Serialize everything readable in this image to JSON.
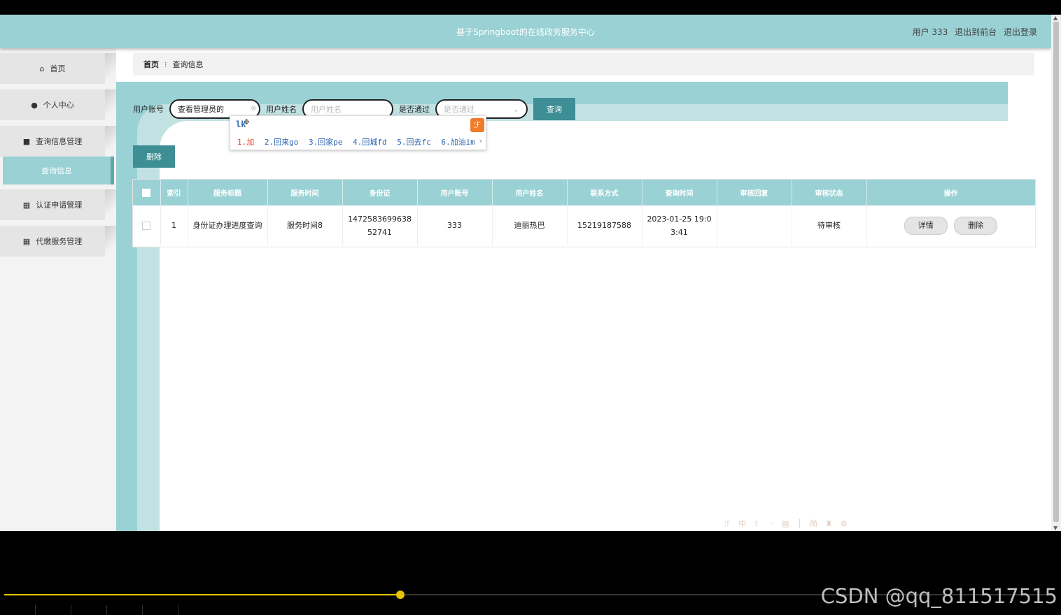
{
  "header": {
    "title": "基于Springboot的在线政务服务中心",
    "user_label": "用户 333",
    "to_front": "退出到前台",
    "logout": "退出登录"
  },
  "sidebar": {
    "items": [
      {
        "label": "首页",
        "icon": "home-icon"
      },
      {
        "label": "个人中心",
        "icon": "user-icon"
      },
      {
        "label": "查询信息管理",
        "icon": "ticket-icon"
      },
      {
        "label": "查询信息",
        "icon": "",
        "active": true
      },
      {
        "label": "认证申请管理",
        "icon": "grid-icon"
      },
      {
        "label": "代缴服务管理",
        "icon": "grid-icon"
      }
    ]
  },
  "breadcrumb": {
    "home": "首页",
    "current": "查询信息"
  },
  "search": {
    "account_label": "用户账号",
    "account_value": "查看管理员的",
    "name_label": "用户姓名",
    "name_placeholder": "用户姓名",
    "pass_label": "是否通过",
    "pass_placeholder": "是否通过",
    "query_button": "查询"
  },
  "actions": {
    "delete_button": "删除"
  },
  "ime": {
    "composition": "lk",
    "candidates": [
      "1.加",
      "2.回来go",
      "3.回家pe",
      "4.回城fd",
      "5.回去fc",
      "6.加油im"
    ]
  },
  "table": {
    "headers": [
      "索引",
      "服务标题",
      "服务时间",
      "身份证",
      "用户账号",
      "用户姓名",
      "联系方式",
      "查询时间",
      "审核回复",
      "审核状态",
      "操作"
    ],
    "rows": [
      {
        "index": "1",
        "title": "身份证办理进度查询",
        "service_time": "服务时间8",
        "id_card": "147258369963852741",
        "account": "333",
        "name": "迪丽热巴",
        "phone": "15219187588",
        "query_time": "2023-01-25 19:03:41",
        "reply": "",
        "status": "待审核",
        "detail_btn": "详情",
        "delete_btn": "删除"
      }
    ]
  },
  "video": {
    "progress": 0.38
  },
  "watermark": "CSDN @qq_811517515",
  "colors": {
    "accent": "#99d1d5",
    "button": "#3e8e95",
    "progress": "#e6c300"
  }
}
